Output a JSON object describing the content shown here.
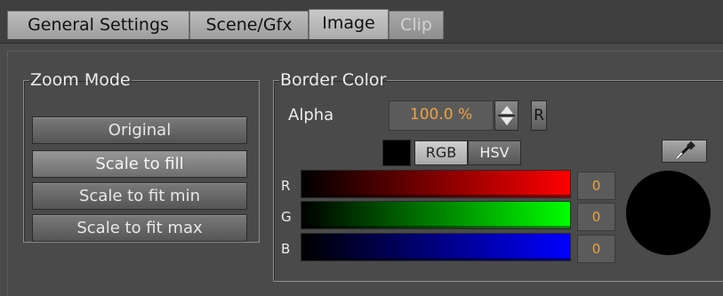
{
  "tabs": [
    {
      "label": "General Settings",
      "state": "normal"
    },
    {
      "label": "Scene/Gfx",
      "state": "normal"
    },
    {
      "label": "Image",
      "state": "active"
    },
    {
      "label": "Clip",
      "state": "disabled"
    }
  ],
  "zoom_mode": {
    "title": "Zoom Mode",
    "options": [
      "Original",
      "Scale to fill",
      "Scale to fit min",
      "Scale to fit max"
    ],
    "selected": "Scale to fill"
  },
  "border_color": {
    "title": "Border Color",
    "alpha_label": "Alpha",
    "alpha_value": "100.0 %",
    "reset_label": "R",
    "swatch_color": "#000000",
    "modes": [
      "RGB",
      "HSV"
    ],
    "active_mode": "RGB",
    "channels": [
      {
        "label": "R",
        "value": "0",
        "color": "#ff0000"
      },
      {
        "label": "G",
        "value": "0",
        "color": "#00ff00"
      },
      {
        "label": "B",
        "value": "0",
        "color": "#0000ff"
      }
    ],
    "picker_icon": "eyedropper-icon",
    "preview_color": "#000000"
  },
  "colors": {
    "value_text": "#f3a23c",
    "background": "#4a4a4a"
  }
}
